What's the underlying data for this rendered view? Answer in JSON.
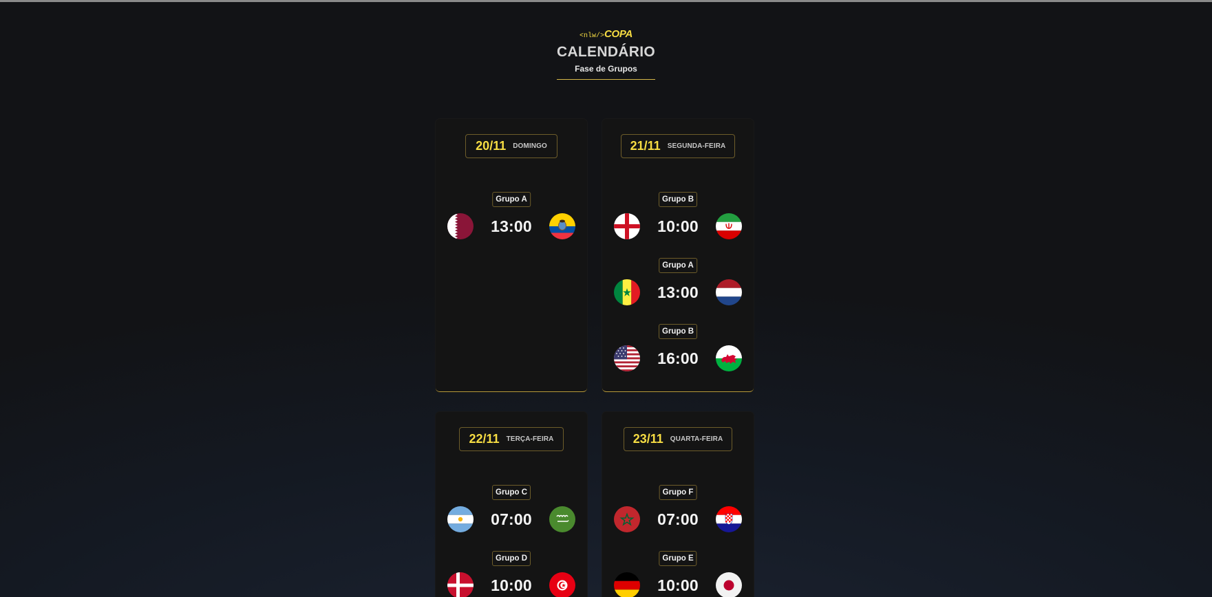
{
  "header": {
    "logo_tag": "<nlw/>",
    "logo_word": "COPA",
    "title": "CALENDÁRIO",
    "subtitle": "Fase de Grupos"
  },
  "days": [
    {
      "date": "20/11",
      "weekday": "DOMINGO",
      "matches": [
        {
          "group": "Grupo A",
          "time": "13:00",
          "home_flag": "qatar-flag-icon",
          "away_flag": "ecuador-flag-icon"
        }
      ]
    },
    {
      "date": "21/11",
      "weekday": "SEGUNDA-FEIRA",
      "matches": [
        {
          "group": "Grupo B",
          "time": "10:00",
          "home_flag": "england-flag-icon",
          "away_flag": "iran-flag-icon"
        },
        {
          "group": "Grupo A",
          "time": "13:00",
          "home_flag": "senegal-flag-icon",
          "away_flag": "netherlands-flag-icon"
        },
        {
          "group": "Grupo B",
          "time": "16:00",
          "home_flag": "usa-flag-icon",
          "away_flag": "wales-flag-icon"
        }
      ]
    },
    {
      "date": "22/11",
      "weekday": "TERÇA-FEIRA",
      "matches": [
        {
          "group": "Grupo C",
          "time": "07:00",
          "home_flag": "argentina-flag-icon",
          "away_flag": "saudi-arabia-flag-icon"
        },
        {
          "group": "Grupo D",
          "time": "10:00",
          "home_flag": "denmark-flag-icon",
          "away_flag": "tunisia-flag-icon"
        }
      ]
    },
    {
      "date": "23/11",
      "weekday": "QUARTA-FEIRA",
      "matches": [
        {
          "group": "Grupo F",
          "time": "07:00",
          "home_flag": "morocco-flag-icon",
          "away_flag": "croatia-flag-icon"
        },
        {
          "group": "Grupo E",
          "time": "10:00",
          "home_flag": "germany-flag-icon",
          "away_flag": "japan-flag-icon"
        }
      ]
    }
  ],
  "colors": {
    "accent": "#f7dd43",
    "card_bg": "#141414",
    "border_gold": "#6e5d2a"
  }
}
